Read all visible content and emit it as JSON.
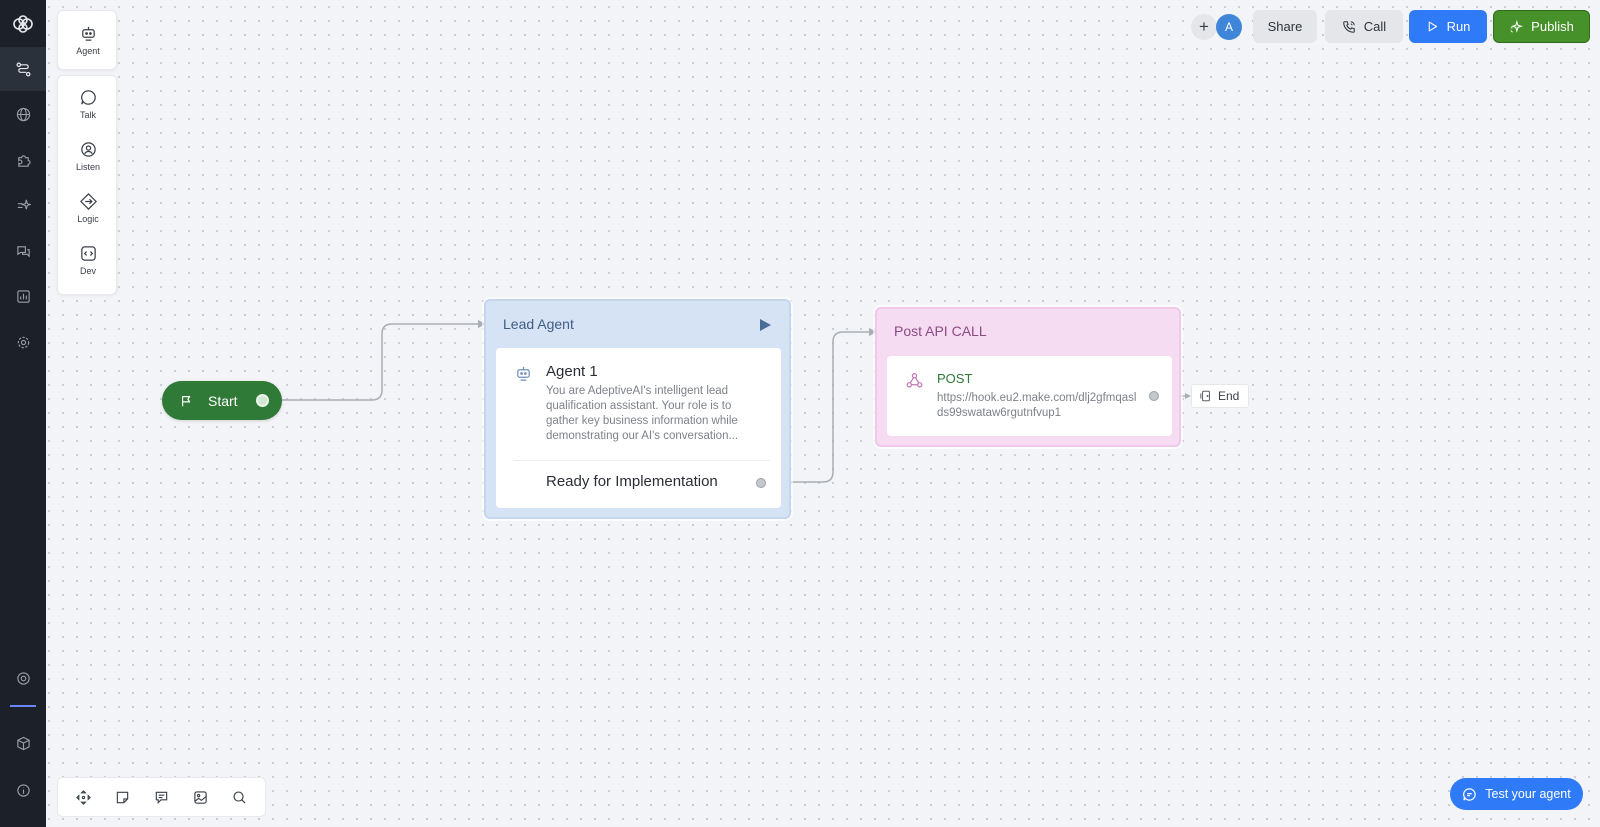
{
  "palette": {
    "agent": "Agent",
    "talk": "Talk",
    "listen": "Listen",
    "logic": "Logic",
    "dev": "Dev"
  },
  "topbar": {
    "avatar_initial": "A",
    "share_label": "Share",
    "call_label": "Call",
    "run_label": "Run",
    "publish_label": "Publish"
  },
  "canvas": {
    "start_label": "Start",
    "lead_agent": {
      "title": "Lead Agent",
      "agent_name": "Agent 1",
      "description": "You are AdeptiveAI's intelligent lead qualification assistant. Your role is to gather key business information while demonstrating our AI's conversation...",
      "exit_label": "Ready for Implementation"
    },
    "post_api": {
      "title": "Post API CALL",
      "method": "POST",
      "url": "https://hook.eu2.make.com/dlj2gfmqaslds99swataw6rgutnfvup1"
    },
    "end_label": "End"
  },
  "test_agent_label": "Test your agent",
  "colors": {
    "rail_bg": "#1c2028",
    "run_blue": "#2f7af7",
    "publish_green": "#46912a",
    "start_green": "#2f7a37",
    "lead_card_bg": "#d6e3f4",
    "api_card_bg": "#f6dcf2"
  }
}
